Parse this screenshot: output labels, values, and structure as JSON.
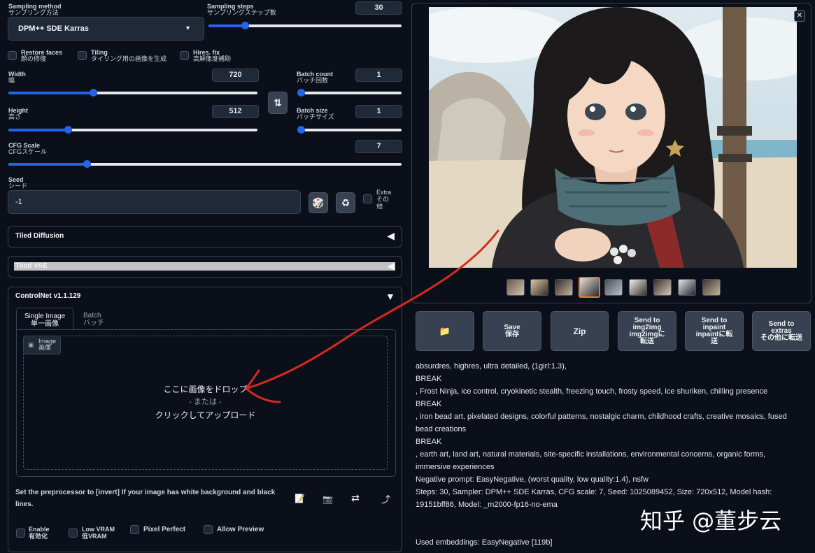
{
  "sampling": {
    "method_label": "Sampling method",
    "method_label_jp": "サンプリング方法",
    "method_value": "DPM++ SDE Karras",
    "steps_label": "Sampling steps",
    "steps_label_jp": "サンプリングステップ数",
    "steps_value": "30",
    "steps_fraction": 0.19
  },
  "options": {
    "restore_faces": "Restore faces",
    "restore_faces_jp": "顔の修復",
    "tiling": "Tiling",
    "tiling_jp": "タイリング用の画像を生成",
    "hires_fix": "Hires. fix",
    "hires_fix_jp": "高解像度補助"
  },
  "width": {
    "label": "Width",
    "label_jp": "幅",
    "value": "720",
    "fraction": 0.34
  },
  "height": {
    "label": "Height",
    "label_jp": "高さ",
    "value": "512",
    "fraction": 0.24
  },
  "batch_count": {
    "label": "Batch count",
    "label_jp": "バッチ回数",
    "value": "1",
    "fraction": 0.0
  },
  "batch_size": {
    "label": "Batch size",
    "label_jp": "バッチサイズ",
    "value": "1",
    "fraction": 0.0
  },
  "cfg": {
    "label": "CFG Scale",
    "label_jp": "CFGスケール",
    "value": "7",
    "fraction": 0.2
  },
  "seed": {
    "label": "Seed",
    "label_jp": "シード",
    "value": "-1",
    "extra": "Extra",
    "extra_jp": "その他"
  },
  "accordions": {
    "tiled_diffusion": "Tiled Diffusion",
    "tiled_vae": "Tiled VAE",
    "controlnet": "ControlNet v1.1.129"
  },
  "controlnet": {
    "tab_single": "Single Image",
    "tab_single_jp": "単一画像",
    "tab_batch": "Batch",
    "tab_batch_jp": "バッチ",
    "image_label": "Image",
    "image_label_jp": "画像",
    "drop_text": "ここに画像をドロップ",
    "or_text": "- または -",
    "click_text": "クリックしてアップロード",
    "hint": "Set the preprocessor to [invert] If your image has white background and black lines.",
    "enable": "Enable",
    "enable_jp": "有効化",
    "low_vram": "Low VRAM",
    "low_vram_jp": "低VRAM",
    "pixel_perfect": "Pixel Perfect",
    "allow_preview": "Allow Preview"
  },
  "output_buttons": {
    "save": "Save",
    "save_jp": "保存",
    "zip": "Zip",
    "img2img": "Send to img2img",
    "img2img_jp": "img2imgに転送",
    "inpaint": "Send to inpaint",
    "inpaint_jp": "inpaintに転送",
    "extras": "Send to extras",
    "extras_jp": "その他に転送"
  },
  "generation_info": [
    "absurdres, highres, ultra detailed, (1girl:1.3),",
    "BREAK",
    ", Frost Ninja, ice control, cryokinetic stealth, freezing touch, frosty speed, ice shuriken, chilling presence",
    "BREAK",
    ", iron bead art, pixelated designs, colorful patterns, nostalgic charm, childhood crafts, creative mosaics, fused bead creations",
    "BREAK",
    ", earth art, land art, natural materials, site-specific installations, environmental concerns, organic forms, immersive experiences",
    "Negative prompt: EasyNegative, (worst quality, low quality:1.4), nsfw",
    "Steps: 30, Sampler: DPM++ SDE Karras, CFG scale: 7, Seed: 1025089452, Size: 720x512, Model hash: 19151bff86, Model: _m2000-fp16-no-ema"
  ],
  "embeddings": "Used embeddings: EasyNegative [119b]",
  "watermark": "知乎 @董步云",
  "colors": {
    "accent": "#2563eb",
    "selected_thumb": "#f97316",
    "annotation": "#d42a20"
  }
}
